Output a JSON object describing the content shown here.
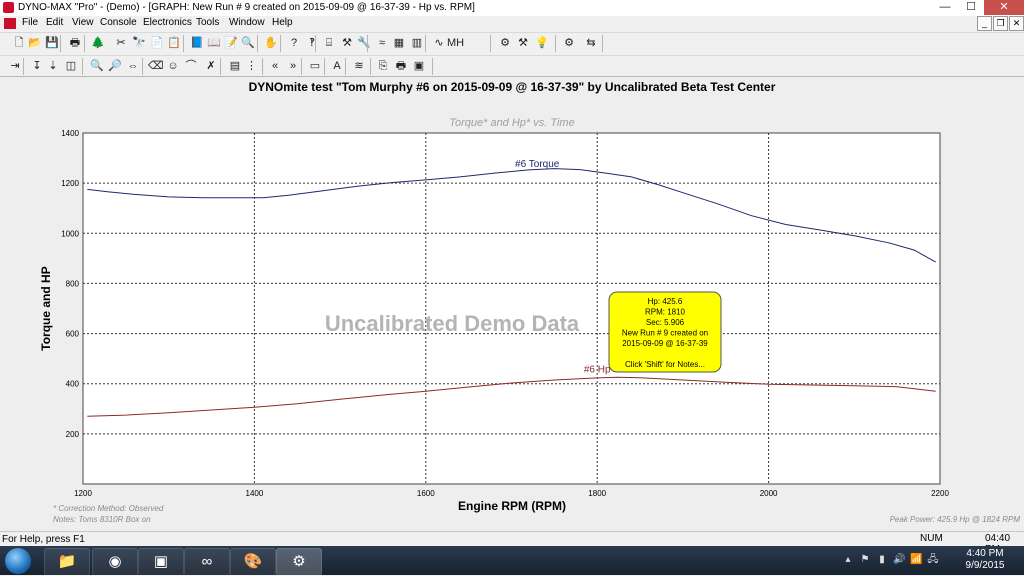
{
  "window": {
    "title": "DYNO-MAX \"Pro\" - (Demo) - [GRAPH: New Run # 9 created on 2015-09-09 @ 16-37-39 - Hp vs. RPM]",
    "controls": [
      "—",
      "☐",
      "✕"
    ]
  },
  "menu": [
    "File",
    "Edit",
    "View",
    "Console",
    "Electronics",
    "Tools",
    "Window",
    "Help"
  ],
  "toolbar1": {
    "icons": [
      "new-file-icon",
      "open-folder-icon",
      "save-icon",
      "print-setup-icon",
      "tree-icon",
      "cut-icon",
      "binoculars-icon",
      "copy-icon",
      "paste-icon",
      "book-icon",
      "book-open-icon",
      "notepad-icon",
      "preview-icon",
      "hand-icon",
      "help-icon",
      "context-help-icon",
      "chart-setup-icon",
      "tools-icon",
      "wrench-icon",
      "calibrate-icon",
      "grid-icon",
      "columns-icon",
      "waveform-icon",
      "mhz-icon",
      "sliders-icon",
      "hammer-icon",
      "bulb-icon",
      "tool-graph-icon",
      "export-icon"
    ],
    "glyphs": [
      "🗋",
      "📂",
      "💾",
      "🖶",
      "🌲",
      "✂",
      "🔭",
      "📄",
      "📋",
      "📘",
      "📖",
      "📝",
      "🔍",
      "✋",
      "?",
      "‽",
      "⌸",
      "⚒",
      "🔧",
      "≈",
      "▦",
      "▥",
      "∿",
      "MH",
      "⚙",
      "⚒",
      "💡",
      "⚙",
      "⇆"
    ]
  },
  "toolbar2": {
    "icons": [
      "pin-icon",
      "cursor-icon",
      "marker-icon",
      "zoom-box-icon",
      "zoom-in-icon",
      "zoom-out-icon",
      "pan-icon",
      "erase-icon",
      "person-icon",
      "curve-icon",
      "red-x-tool-icon",
      "data-table-icon",
      "channels-icon",
      "prev-run-icon",
      "next-run-icon",
      "tabular-icon",
      "text-tool-icon",
      "legend-icon",
      "copy-graph-icon",
      "print-graph-icon",
      "notes-icon"
    ],
    "glyphs": [
      "⇥",
      "↧",
      "⇣",
      "◫",
      "🔍",
      "🔎",
      "⇔",
      "⌫",
      "☺",
      "⌒",
      "✗",
      "▤",
      "⋮⋮",
      "«",
      "»",
      "▭",
      "A",
      "≋",
      "⎘",
      "🖶",
      "▣"
    ]
  },
  "graph": {
    "title": "DYNOmite test \"Tom Murphy #6 on 2015-09-09 @ 16-37-39\" by Uncalibrated Beta Test Center",
    "subtitle": "Torque* and Hp* vs. Time",
    "watermark": "Uncalibrated Demo Data",
    "correction_note": "* Correction Method: Observed",
    "notes": "Notes: Toms 8310R Box on",
    "peak_power": "Peak Power: 425.9 Hp @ 1824 RPM",
    "tooltip": {
      "lines": [
        "Hp:  425.6",
        "RPM:  1810",
        "Sec:  5.906",
        "New Run # 9 created on",
        "2015-09-09 @ 16-37-39",
        "",
        "Click 'Shift' for Notes..."
      ]
    }
  },
  "chart_data": {
    "type": "line",
    "title": "DYNOmite test \"Tom Murphy #6 on 2015-09-09 @ 16-37-39\" by Uncalibrated Beta Test Center",
    "subtitle": "Torque* and Hp* vs. Time",
    "xlabel": "Engine RPM (RPM)",
    "ylabel": "Torque and HP",
    "xlim": [
      1200,
      2200
    ],
    "ylim": [
      0,
      1400
    ],
    "xticks": [
      1200,
      1400,
      1600,
      1800,
      2000,
      2200
    ],
    "yticks": [
      200,
      400,
      600,
      800,
      1000,
      1200,
      1400
    ],
    "grid": true,
    "series": [
      {
        "name": "#6 Torque",
        "color": "#1c2a6e",
        "x": [
          1205,
          1230,
          1260,
          1300,
          1340,
          1380,
          1410,
          1440,
          1480,
          1520,
          1560,
          1600,
          1640,
          1680,
          1720,
          1750,
          1780,
          1810,
          1840,
          1870,
          1900,
          1940,
          1980,
          2020,
          2060,
          2100,
          2140,
          2170,
          2195
        ],
        "values": [
          1175,
          1165,
          1155,
          1145,
          1142,
          1142,
          1142,
          1152,
          1170,
          1188,
          1202,
          1213,
          1225,
          1240,
          1253,
          1258,
          1254,
          1240,
          1225,
          1195,
          1162,
          1118,
          1070,
          1035,
          1013,
          990,
          962,
          933,
          885
        ]
      },
      {
        "name": "#6 Hp",
        "color": "#8b2a2a",
        "x": [
          1205,
          1250,
          1300,
          1350,
          1400,
          1450,
          1500,
          1550,
          1600,
          1650,
          1700,
          1750,
          1800,
          1824,
          1850,
          1900,
          1950,
          2000,
          2050,
          2100,
          2150,
          2195
        ],
        "values": [
          270,
          275,
          284,
          295,
          306,
          320,
          338,
          355,
          370,
          387,
          403,
          415,
          423,
          425.9,
          424,
          415,
          406,
          398,
          395,
          392,
          388,
          370
        ]
      }
    ],
    "labels": [
      {
        "text": "#6 Torque",
        "x": 1730,
        "y": 1265
      },
      {
        "text": "#6 Hp",
        "x": 1800,
        "y": 445
      }
    ]
  },
  "status": {
    "help": "For Help, press F1",
    "num": "NUM",
    "time": "04:40 PM"
  },
  "taskbar": {
    "apps": [
      "folder-icon",
      "chrome-icon",
      "task-manager-icon",
      "dynomite-icon",
      "paint-icon",
      "dyno-max-icon"
    ],
    "glyphs": [
      "📁",
      "◉",
      "▣",
      "∞",
      "🎨",
      "⚙"
    ],
    "tray": [
      "▴",
      "⚑",
      "▮",
      "🔊",
      "📶",
      "🖧"
    ],
    "clock_time": "4:40 PM",
    "clock_date": "9/9/2015"
  }
}
